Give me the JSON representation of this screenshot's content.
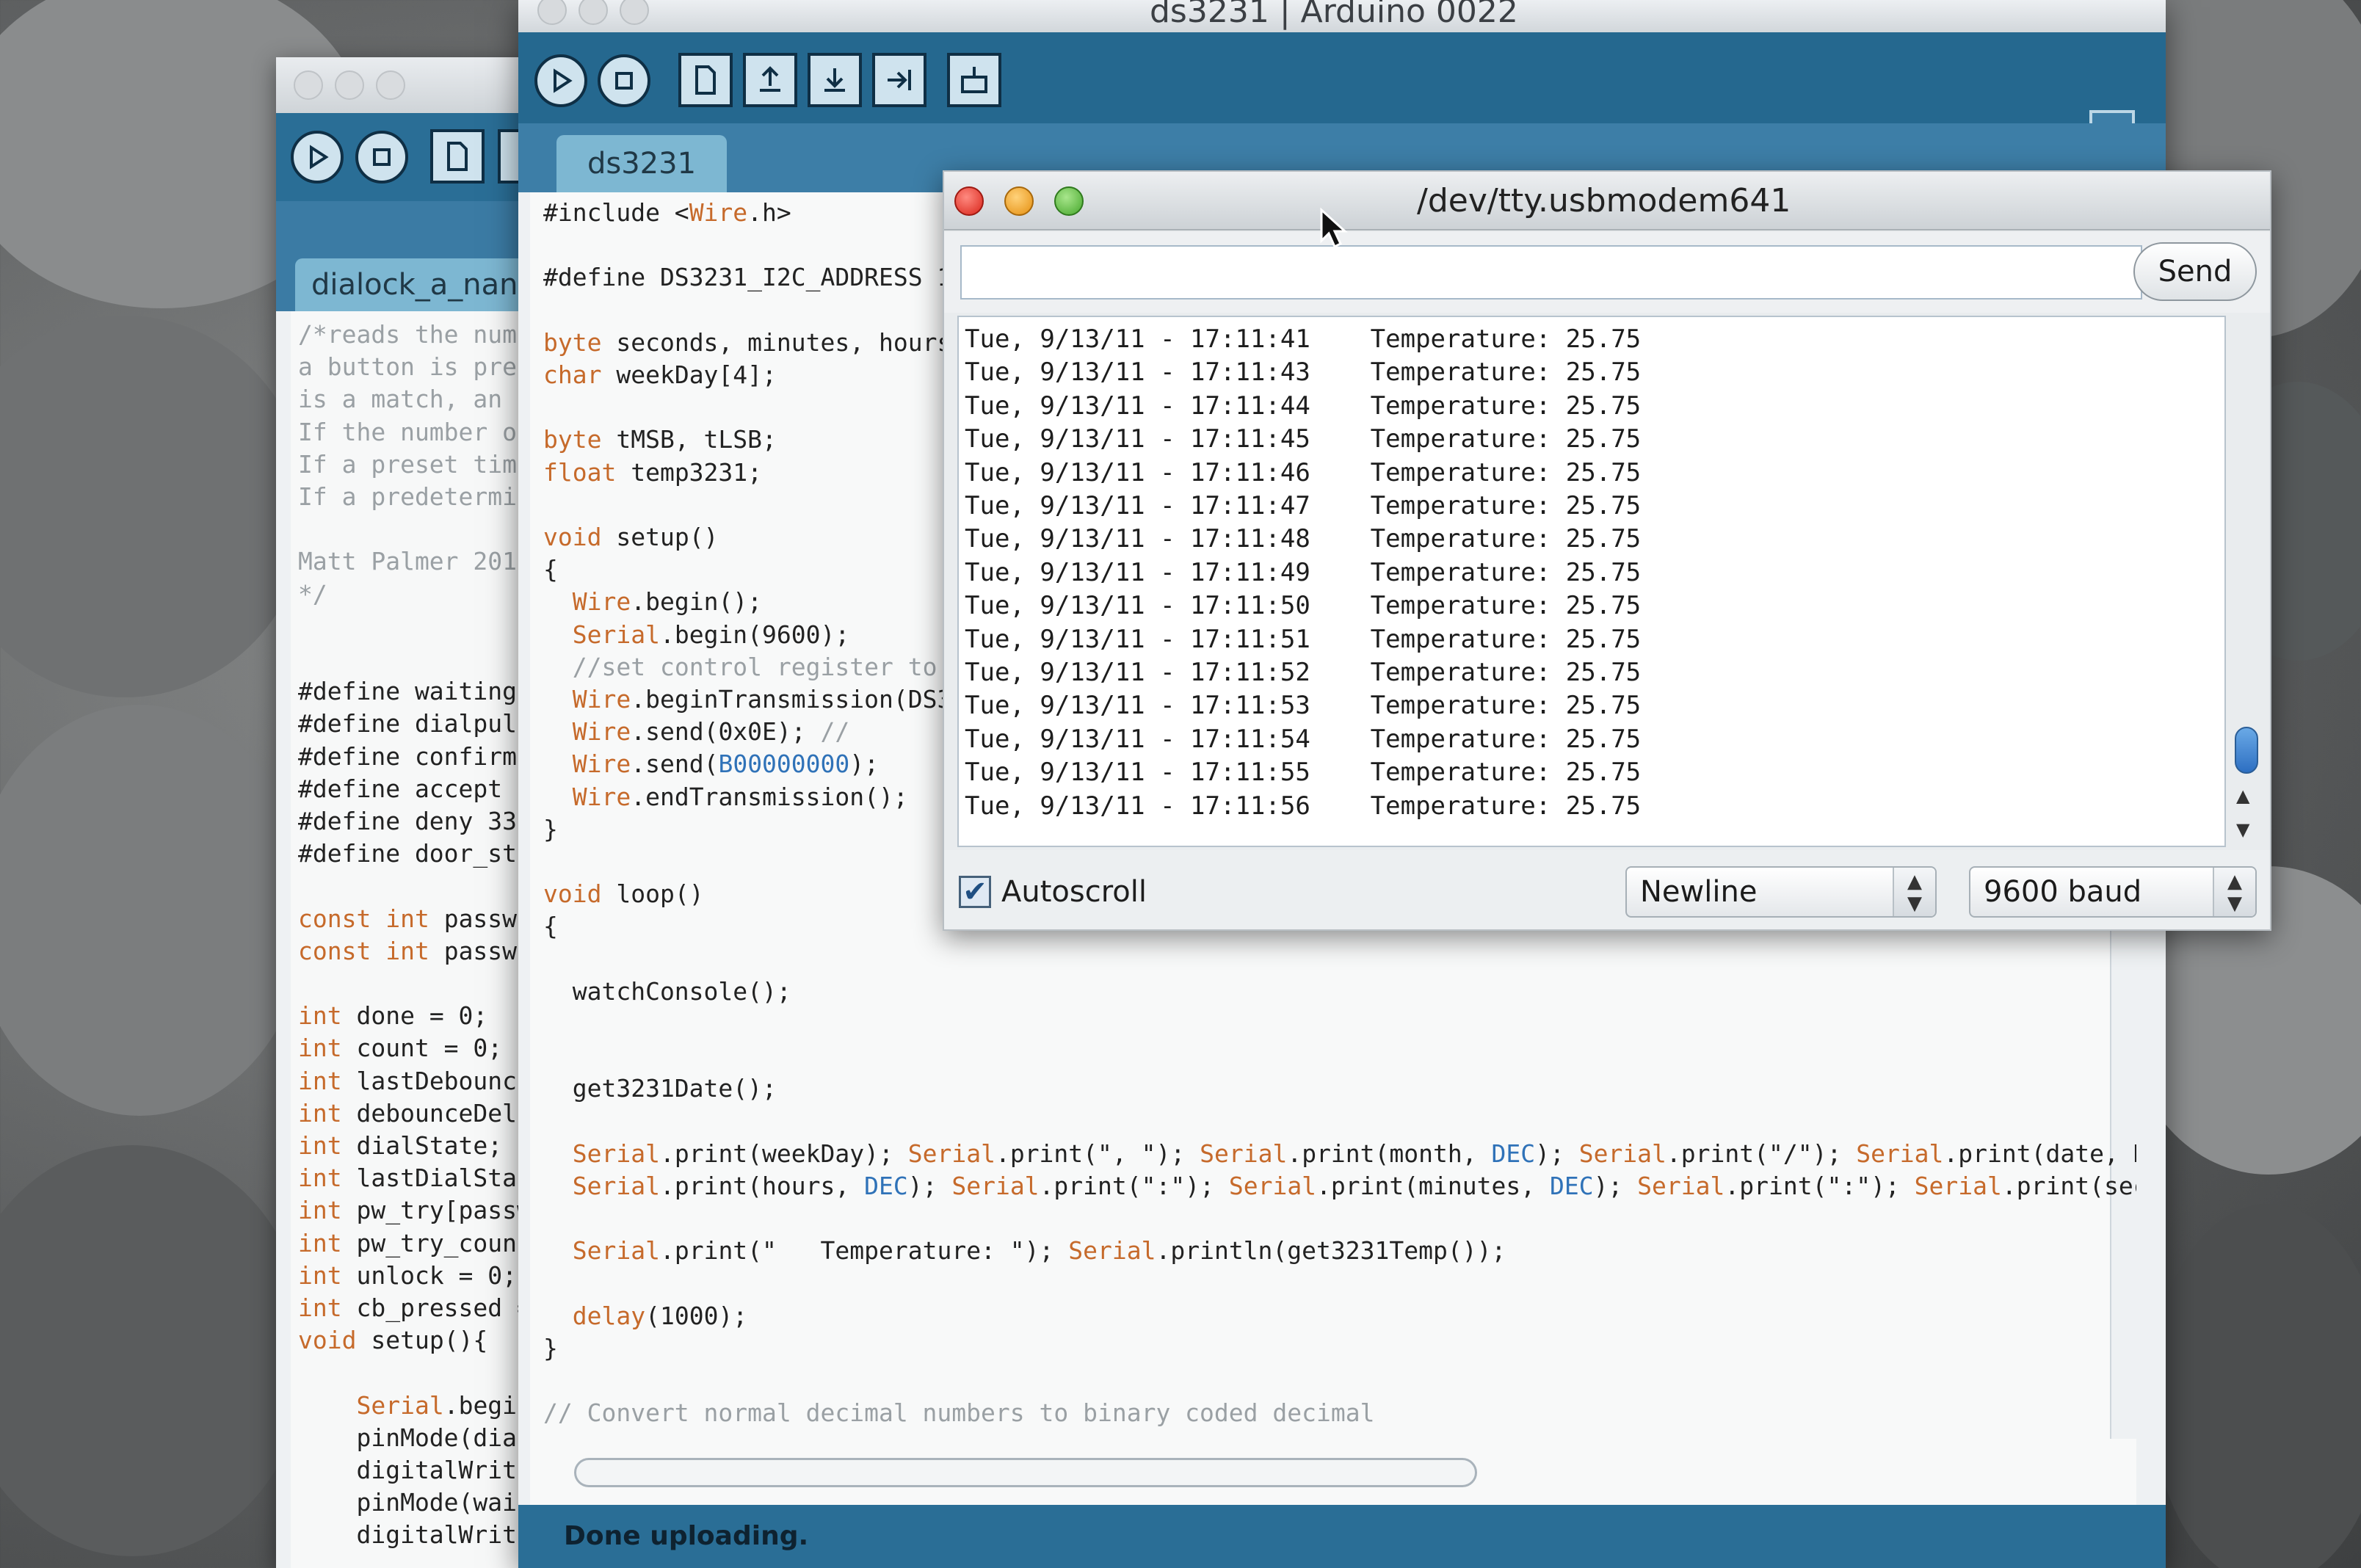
{
  "back_window": {
    "tab_label": "dialock_a_nan",
    "code_lines": [
      "/*reads the numb",
      "a button is pres",
      "is a match, an e",
      "If the number of",
      "If a preset time",
      "If a predetermin",
      "",
      "Matt Palmer 2011",
      "*/",
      "",
      "",
      "#define waiting",
      "#define dialpuls",
      "#define confirma",
      "#define accept 3",
      "#define deny 33",
      "#define door_str",
      "",
      "const int passwo",
      "const int passwo",
      "",
      "int done = 0;",
      "int count = 0;",
      "int lastDebounce",
      "int debounceDela",
      "int dialState;",
      "int lastDialStat",
      "int pw_try[passw",
      "int pw_try_count",
      "int unlock = 0;",
      "int cb_pressed =",
      "void setup(){",
      "",
      "    Serial.begin",
      "    pinMode(dial",
      "    digitalWrite",
      "    pinMode(wait",
      "    digitalWrite"
    ]
  },
  "main_window": {
    "title": "ds3231 | Arduino 0022",
    "tab_label": "ds3231",
    "status_text": "Done uploading.",
    "toolbar": [
      "verify-icon",
      "stop-icon",
      "new-icon",
      "open-icon",
      "save-icon",
      "upload-icon",
      "serial-monitor-icon"
    ],
    "code_lines": [
      "#include <Wire.h>",
      "",
      "#define DS3231_I2C_ADDRESS 1",
      "",
      "byte seconds, minutes, hours",
      "char weekDay[4];",
      "",
      "byte tMSB, tLSB;",
      "float temp3231;",
      "",
      "void setup()",
      "{",
      "  Wire.begin();",
      "  Serial.begin(9600);",
      "  //set control register to",
      "  Wire.beginTransmission(DS3",
      "  Wire.send(0x0E); //",
      "  Wire.send(B00000000);",
      "  Wire.endTransmission();",
      "}",
      "",
      "void loop()",
      "{",
      "",
      "  watchConsole();",
      "",
      "",
      "  get3231Date();",
      "",
      "  Serial.print(weekDay); Serial.print(\", \"); Serial.print(month, DEC); Serial.print(\"/\"); Serial.print(date, D",
      "  Serial.print(hours, DEC); Serial.print(\":\"); Serial.print(minutes, DEC); Serial.print(\":\"); Serial.print(sec",
      "",
      "  Serial.print(\"   Temperature: \"); Serial.println(get3231Temp());",
      "",
      "  delay(1000);",
      "}",
      "",
      "// Convert normal decimal numbers to binary coded decimal"
    ]
  },
  "serial_monitor": {
    "title": "/dev/tty.usbmodem641",
    "send_label": "Send",
    "send_value": "",
    "autoscroll_label": "Autoscroll",
    "autoscroll_checked": true,
    "line_ending": "Newline",
    "baud": "9600 baud",
    "output_lines": [
      "Tue, 9/13/11 - 17:11:41    Temperature: 25.75",
      "Tue, 9/13/11 - 17:11:43    Temperature: 25.75",
      "Tue, 9/13/11 - 17:11:44    Temperature: 25.75",
      "Tue, 9/13/11 - 17:11:45    Temperature: 25.75",
      "Tue, 9/13/11 - 17:11:46    Temperature: 25.75",
      "Tue, 9/13/11 - 17:11:47    Temperature: 25.75",
      "Tue, 9/13/11 - 17:11:48    Temperature: 25.75",
      "Tue, 9/13/11 - 17:11:49    Temperature: 25.75",
      "Tue, 9/13/11 - 17:11:50    Temperature: 25.75",
      "Tue, 9/13/11 - 17:11:51    Temperature: 25.75",
      "Tue, 9/13/11 - 17:11:52    Temperature: 25.75",
      "Tue, 9/13/11 - 17:11:53    Temperature: 25.75",
      "Tue, 9/13/11 - 17:11:54    Temperature: 25.75",
      "Tue, 9/13/11 - 17:11:55    Temperature: 25.75",
      "Tue, 9/13/11 - 17:11:56    Temperature: 25.75"
    ]
  },
  "colors": {
    "toolbar": "#25688f",
    "tab": "#7db7d2",
    "keyword": "#c66a2b",
    "comment": "#9aa0a4",
    "constant": "#2f72b8"
  }
}
